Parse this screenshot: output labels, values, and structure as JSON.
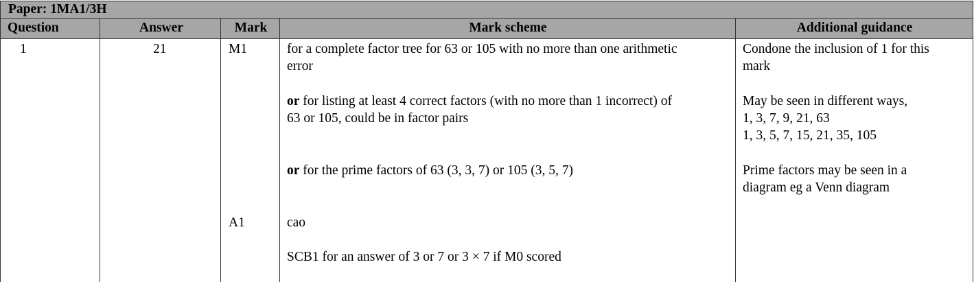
{
  "paper": {
    "title": "Paper: 1MA1/3H"
  },
  "headers": {
    "question": "Question",
    "answer": "Answer",
    "mark": "Mark",
    "mark_scheme": "Mark scheme",
    "additional_guidance": "Additional guidance"
  },
  "row": {
    "question": "1",
    "answer": "21",
    "marks": [
      "M1",
      "A1"
    ],
    "scheme": {
      "line1": "for a complete factor tree for 63 or 105 with no more than one arithmetic",
      "line1b": "error",
      "or1_keyword": "or",
      "line2": " for listing at least 4 correct factors (with no more than 1 incorrect) of",
      "line2b": "63 or 105, could be in factor pairs",
      "or2_keyword": "or",
      "line3": " for the prime factors of 63 (3, 3, 7) or 105 (3, 5, 7)",
      "line4": "cao",
      "line5": "SCB1 for an answer of 3 or 7 or 3 × 7 if M0 scored"
    },
    "guidance": {
      "g1a": "Condone the inclusion of 1 for this",
      "g1b": "mark",
      "g2a": "May be seen in different ways,",
      "g2b": "1, 3, 7, 9, 21, 63",
      "g2c": "1, 3, 5, 7, 15, 21, 35, 105",
      "g3a": "Prime factors may be seen in a",
      "g3b": "diagram eg a Venn diagram"
    }
  }
}
